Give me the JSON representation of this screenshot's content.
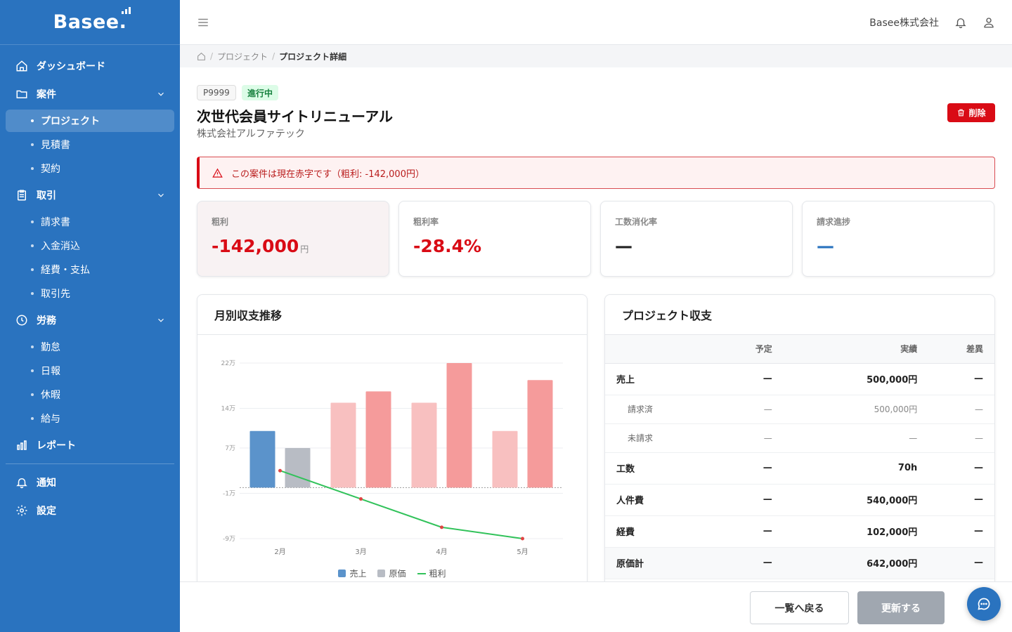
{
  "app": {
    "logo": "Basee"
  },
  "sidebar": {
    "dashboard": "ダッシュボード",
    "cases": {
      "label": "案件",
      "items": [
        "プロジェクト",
        "見積書",
        "契約"
      ]
    },
    "transactions": {
      "label": "取引",
      "items": [
        "請求書",
        "入金消込",
        "経費・支払",
        "取引先"
      ]
    },
    "labor": {
      "label": "労務",
      "items": [
        "勤怠",
        "日報",
        "休暇",
        "給与"
      ]
    },
    "report": "レポート",
    "notifications": "通知",
    "settings": "設定"
  },
  "header": {
    "company": "Basee株式会社"
  },
  "breadcrumb": {
    "level1": "プロジェクト",
    "current": "プロジェクト詳細"
  },
  "project": {
    "code": "P9999",
    "status": "進行中",
    "title": "次世代会員サイトリニューアル",
    "client": "株式会社アルファテック",
    "delete_label": "削除"
  },
  "alert": {
    "message": "この案件は現在赤字です（粗利: -142,000円）"
  },
  "kpis": [
    {
      "label": "粗利",
      "value": "-142,000",
      "unit": "円"
    },
    {
      "label": "粗利率",
      "value": "-28.4%"
    },
    {
      "label": "工数消化率",
      "value": "—"
    },
    {
      "label": "請求進捗",
      "value": "—"
    }
  ],
  "chart_panel": {
    "title": "月別収支推移"
  },
  "chart_data": {
    "type": "bar",
    "categories": [
      "2月",
      "3月",
      "4月",
      "5月"
    ],
    "ytick_labels": [
      "22万",
      "14万",
      "7万",
      "-1万",
      "-9万"
    ],
    "ytick_values": [
      220000,
      140000,
      70000,
      -10000,
      -90000
    ],
    "ylim": [
      -90000,
      220000
    ],
    "series": [
      {
        "name": "売上",
        "type": "bar",
        "values": [
          100000,
          150000,
          150000,
          100000
        ]
      },
      {
        "name": "原価",
        "type": "bar",
        "values": [
          70000,
          170000,
          220000,
          190000
        ]
      },
      {
        "name": "粗利",
        "type": "line",
        "values": [
          30000,
          -20000,
          -70000,
          -90000
        ]
      }
    ],
    "colors": {
      "sales": "#5b93cb",
      "cost": "#b8bcc4",
      "sales_loss": "#f8c0c0",
      "cost_loss": "#f59b9b",
      "profit": "#31c25a",
      "profit_point": "#e04444"
    },
    "legend_position": "bottom"
  },
  "table_panel": {
    "title": "プロジェクト収支",
    "headers": [
      "",
      "予定",
      "実績",
      "差異"
    ],
    "rows": [
      {
        "label": "売上",
        "plan": "—",
        "actual": "500,000円",
        "diff": "—",
        "kind": "main"
      },
      {
        "label": "請求済",
        "plan": "—",
        "actual": "500,000円",
        "diff": "—",
        "kind": "sub"
      },
      {
        "label": "未請求",
        "plan": "—",
        "actual": "—",
        "diff": "—",
        "kind": "sub"
      },
      {
        "label": "工数",
        "plan": "—",
        "actual": "70h",
        "diff": "—",
        "kind": "main"
      },
      {
        "label": "人件費",
        "plan": "—",
        "actual": "540,000円",
        "diff": "—",
        "kind": "main"
      },
      {
        "label": "経費",
        "plan": "—",
        "actual": "102,000円",
        "diff": "—",
        "kind": "main"
      },
      {
        "label": "原価計",
        "plan": "—",
        "actual": "642,000円",
        "diff": "—",
        "kind": "total"
      }
    ]
  },
  "footer": {
    "back_label": "一覧へ戻る",
    "update_label": "更新する"
  }
}
